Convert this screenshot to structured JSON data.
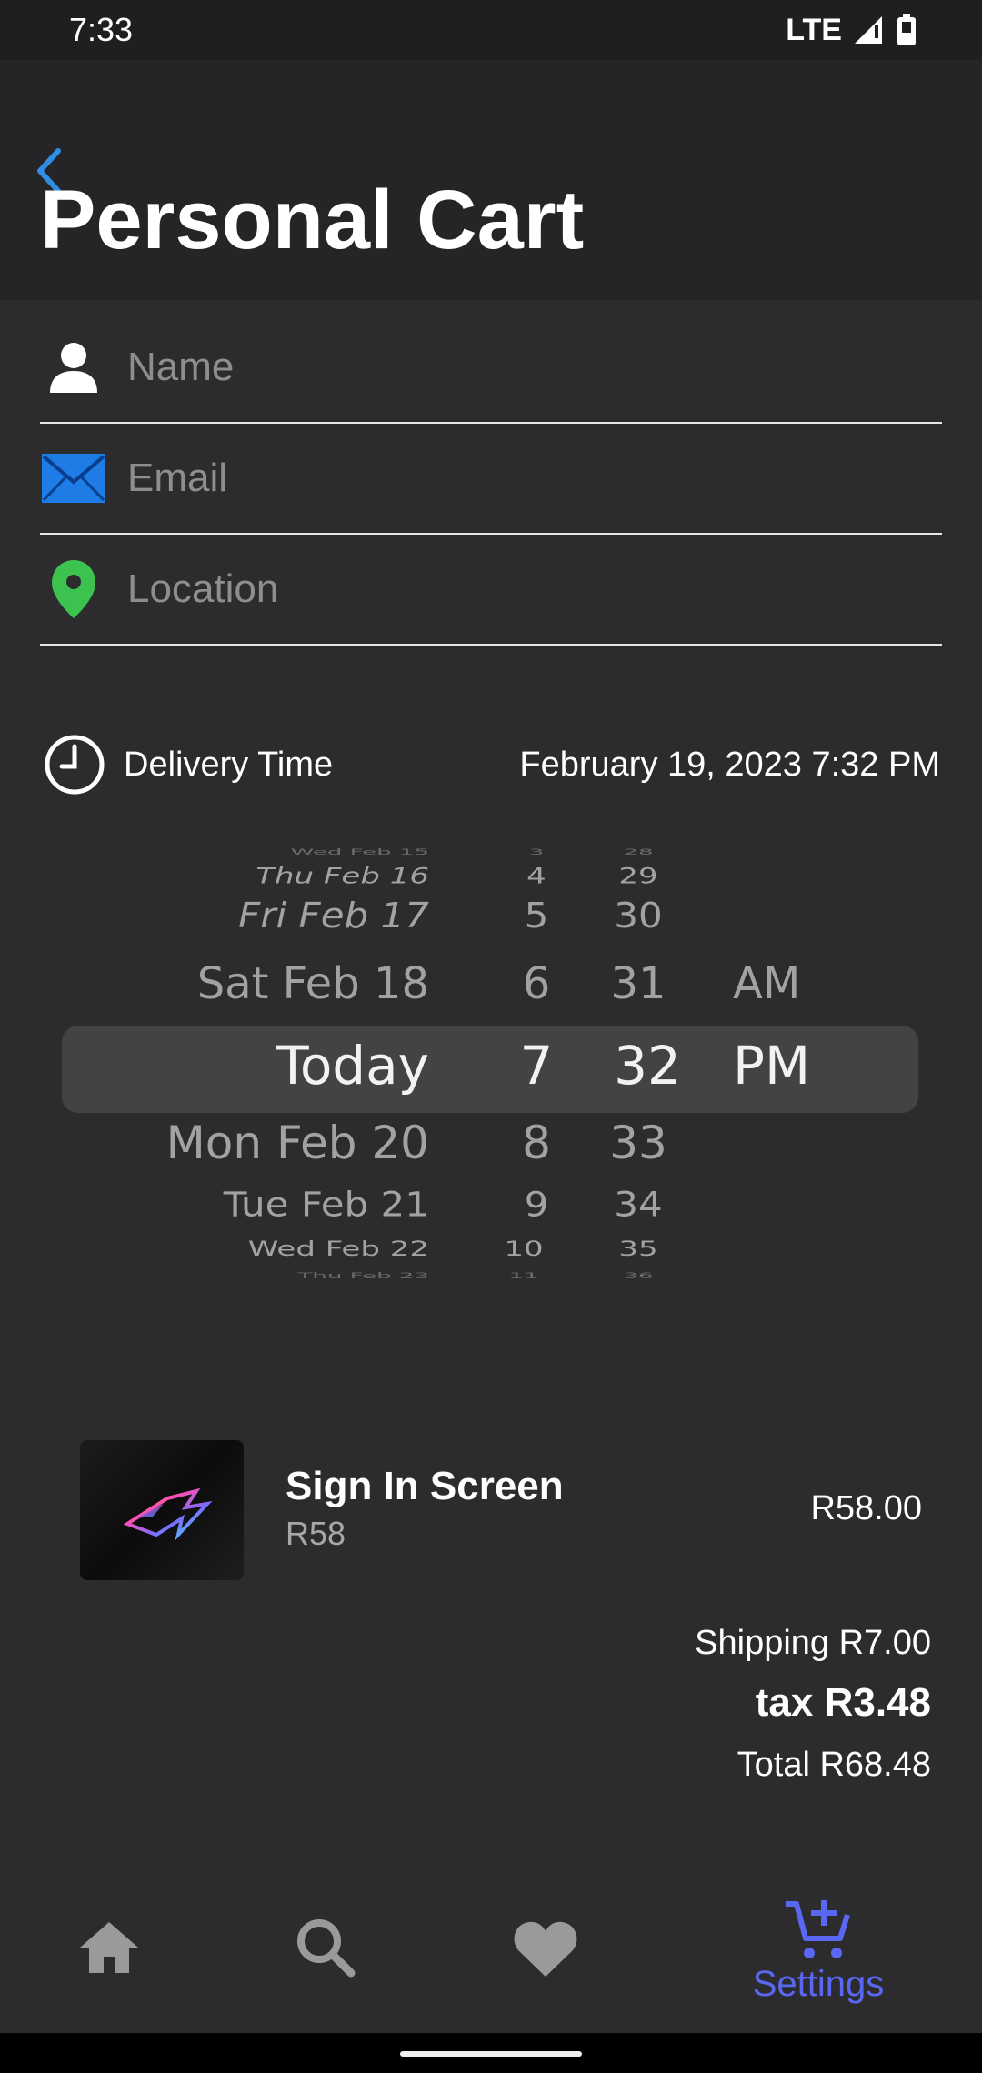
{
  "status_bar": {
    "time": "7:33",
    "network": "LTE"
  },
  "header": {
    "title": "Personal Cart"
  },
  "form": {
    "name_placeholder": "Name",
    "email_placeholder": "Email",
    "location_placeholder": "Location"
  },
  "delivery": {
    "label": "Delivery Time",
    "value": "February 19, 2023 7:32 PM"
  },
  "picker": {
    "dates": [
      "Wed Feb 15",
      "Thu Feb 16",
      "Fri Feb 17",
      "Sat Feb 18",
      "Today",
      "Mon Feb 20",
      "Tue Feb 21",
      "Wed Feb 22",
      "Thu Feb 23"
    ],
    "hours": [
      "3",
      "4",
      "5",
      "6",
      "7",
      "8",
      "9",
      "10",
      "11"
    ],
    "minutes": [
      "28",
      "29",
      "30",
      "31",
      "32",
      "33",
      "34",
      "35",
      "36"
    ],
    "ampm": [
      "AM",
      "PM"
    ],
    "selected_date": "Today",
    "selected_hour": "7",
    "selected_minute": "32",
    "selected_ampm": "PM"
  },
  "cart": {
    "items": [
      {
        "title": "Sign In Screen",
        "subtitle": "R58",
        "price": "R58.00"
      }
    ],
    "shipping": "Shipping R7.00",
    "tax": "tax R3.48",
    "total": "Total R68.48"
  },
  "bottom_nav": {
    "items": [
      {
        "icon": "home-icon",
        "label": ""
      },
      {
        "icon": "search-icon",
        "label": ""
      },
      {
        "icon": "heart-icon",
        "label": ""
      },
      {
        "icon": "cart-add-icon",
        "label": "Settings"
      }
    ]
  },
  "colors": {
    "accent": "#5a67f2",
    "back_arrow": "#2f8de4",
    "email_icon": "#1e7ce6",
    "location_icon": "#3cc24f",
    "background": "#2c2c2e"
  }
}
